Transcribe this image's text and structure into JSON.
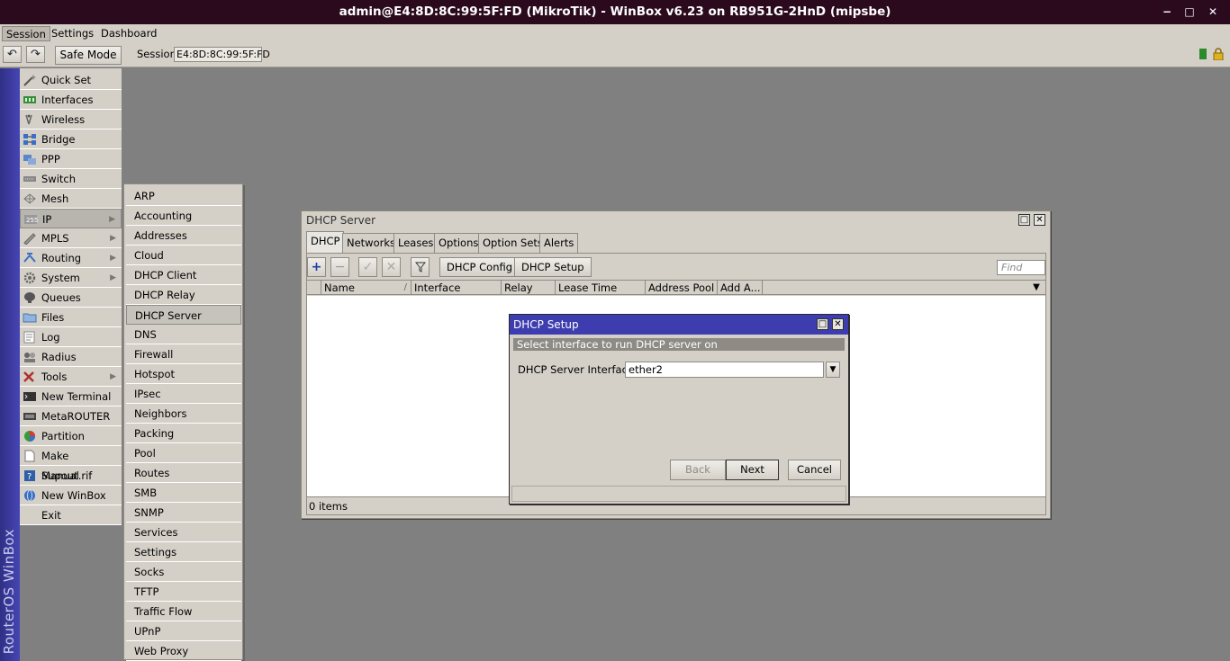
{
  "window": {
    "title": "admin@E4:8D:8C:99:5F:FD (MikroTik) - WinBox v6.23 on RB951G-2HnD (mipsbe)",
    "controls": [
      "−",
      "□",
      "✕"
    ]
  },
  "menubar": {
    "items": [
      "Session",
      "Settings",
      "Dashboard"
    ],
    "active": "Session"
  },
  "toolbar": {
    "undo": "↶",
    "redo": "↷",
    "safe_mode": "Safe Mode",
    "session_label": "Session",
    "session_value": "E4:8D:8C:99:5F:FD"
  },
  "brand": "RouterOS WinBox",
  "sidebar": {
    "items": [
      {
        "label": "Quick Set",
        "icon": "wand-icon",
        "arrow": ""
      },
      {
        "label": "Interfaces",
        "icon": "interfaces-icon",
        "arrow": ""
      },
      {
        "label": "Wireless",
        "icon": "wireless-icon",
        "arrow": ""
      },
      {
        "label": "Bridge",
        "icon": "bridge-icon",
        "arrow": ""
      },
      {
        "label": "PPP",
        "icon": "ppp-icon",
        "arrow": ""
      },
      {
        "label": "Switch",
        "icon": "switch-icon",
        "arrow": ""
      },
      {
        "label": "Mesh",
        "icon": "mesh-icon",
        "arrow": ""
      },
      {
        "label": "IP",
        "icon": "ip-icon",
        "arrow": "▶"
      },
      {
        "label": "MPLS",
        "icon": "mpls-icon",
        "arrow": "▶"
      },
      {
        "label": "Routing",
        "icon": "routing-icon",
        "arrow": "▶"
      },
      {
        "label": "System",
        "icon": "gear-icon",
        "arrow": "▶"
      },
      {
        "label": "Queues",
        "icon": "queues-icon",
        "arrow": ""
      },
      {
        "label": "Files",
        "icon": "folder-icon",
        "arrow": ""
      },
      {
        "label": "Log",
        "icon": "log-icon",
        "arrow": ""
      },
      {
        "label": "Radius",
        "icon": "radius-icon",
        "arrow": ""
      },
      {
        "label": "Tools",
        "icon": "tools-icon",
        "arrow": "▶"
      },
      {
        "label": "New Terminal",
        "icon": "terminal-icon",
        "arrow": ""
      },
      {
        "label": "MetaROUTER",
        "icon": "metarouter-icon",
        "arrow": ""
      },
      {
        "label": "Partition",
        "icon": "partition-icon",
        "arrow": ""
      },
      {
        "label": "Make Supout.rif",
        "icon": "document-icon",
        "arrow": ""
      },
      {
        "label": "Manual",
        "icon": "help-icon",
        "arrow": ""
      },
      {
        "label": "New WinBox",
        "icon": "globe-icon",
        "arrow": ""
      },
      {
        "label": "Exit",
        "icon": "exit-icon",
        "arrow": ""
      }
    ],
    "selected": "IP"
  },
  "ip_submenu": {
    "items": [
      "ARP",
      "Accounting",
      "Addresses",
      "Cloud",
      "DHCP Client",
      "DHCP Relay",
      "DHCP Server",
      "DNS",
      "Firewall",
      "Hotspot",
      "IPsec",
      "Neighbors",
      "Packing",
      "Pool",
      "Routes",
      "SMB",
      "SNMP",
      "Services",
      "Settings",
      "Socks",
      "TFTP",
      "Traffic Flow",
      "UPnP",
      "Web Proxy"
    ],
    "selected": "DHCP Server"
  },
  "dhcp_window": {
    "title": "DHCP Server",
    "tabs": [
      "DHCP",
      "Networks",
      "Leases",
      "Options",
      "Option Sets",
      "Alerts"
    ],
    "active_tab": "DHCP",
    "buttons": {
      "add": "+",
      "remove": "−",
      "enable": "✓",
      "disable": "✕",
      "filter": "▼",
      "dhcp_config": "DHCP Config",
      "dhcp_setup": "DHCP Setup"
    },
    "find_placeholder": "Find",
    "columns": [
      "Name",
      "Interface",
      "Relay",
      "Lease Time",
      "Address Pool",
      "Add A..."
    ],
    "sort_indicator": "/",
    "rows": [],
    "status": "0 items"
  },
  "setup_dialog": {
    "title": "DHCP Setup",
    "hint": "Select interface to run DHCP server on",
    "field_label": "DHCP Server Interface",
    "field_value": "ether2",
    "buttons": {
      "back": "Back",
      "next": "Next",
      "cancel": "Cancel"
    }
  }
}
